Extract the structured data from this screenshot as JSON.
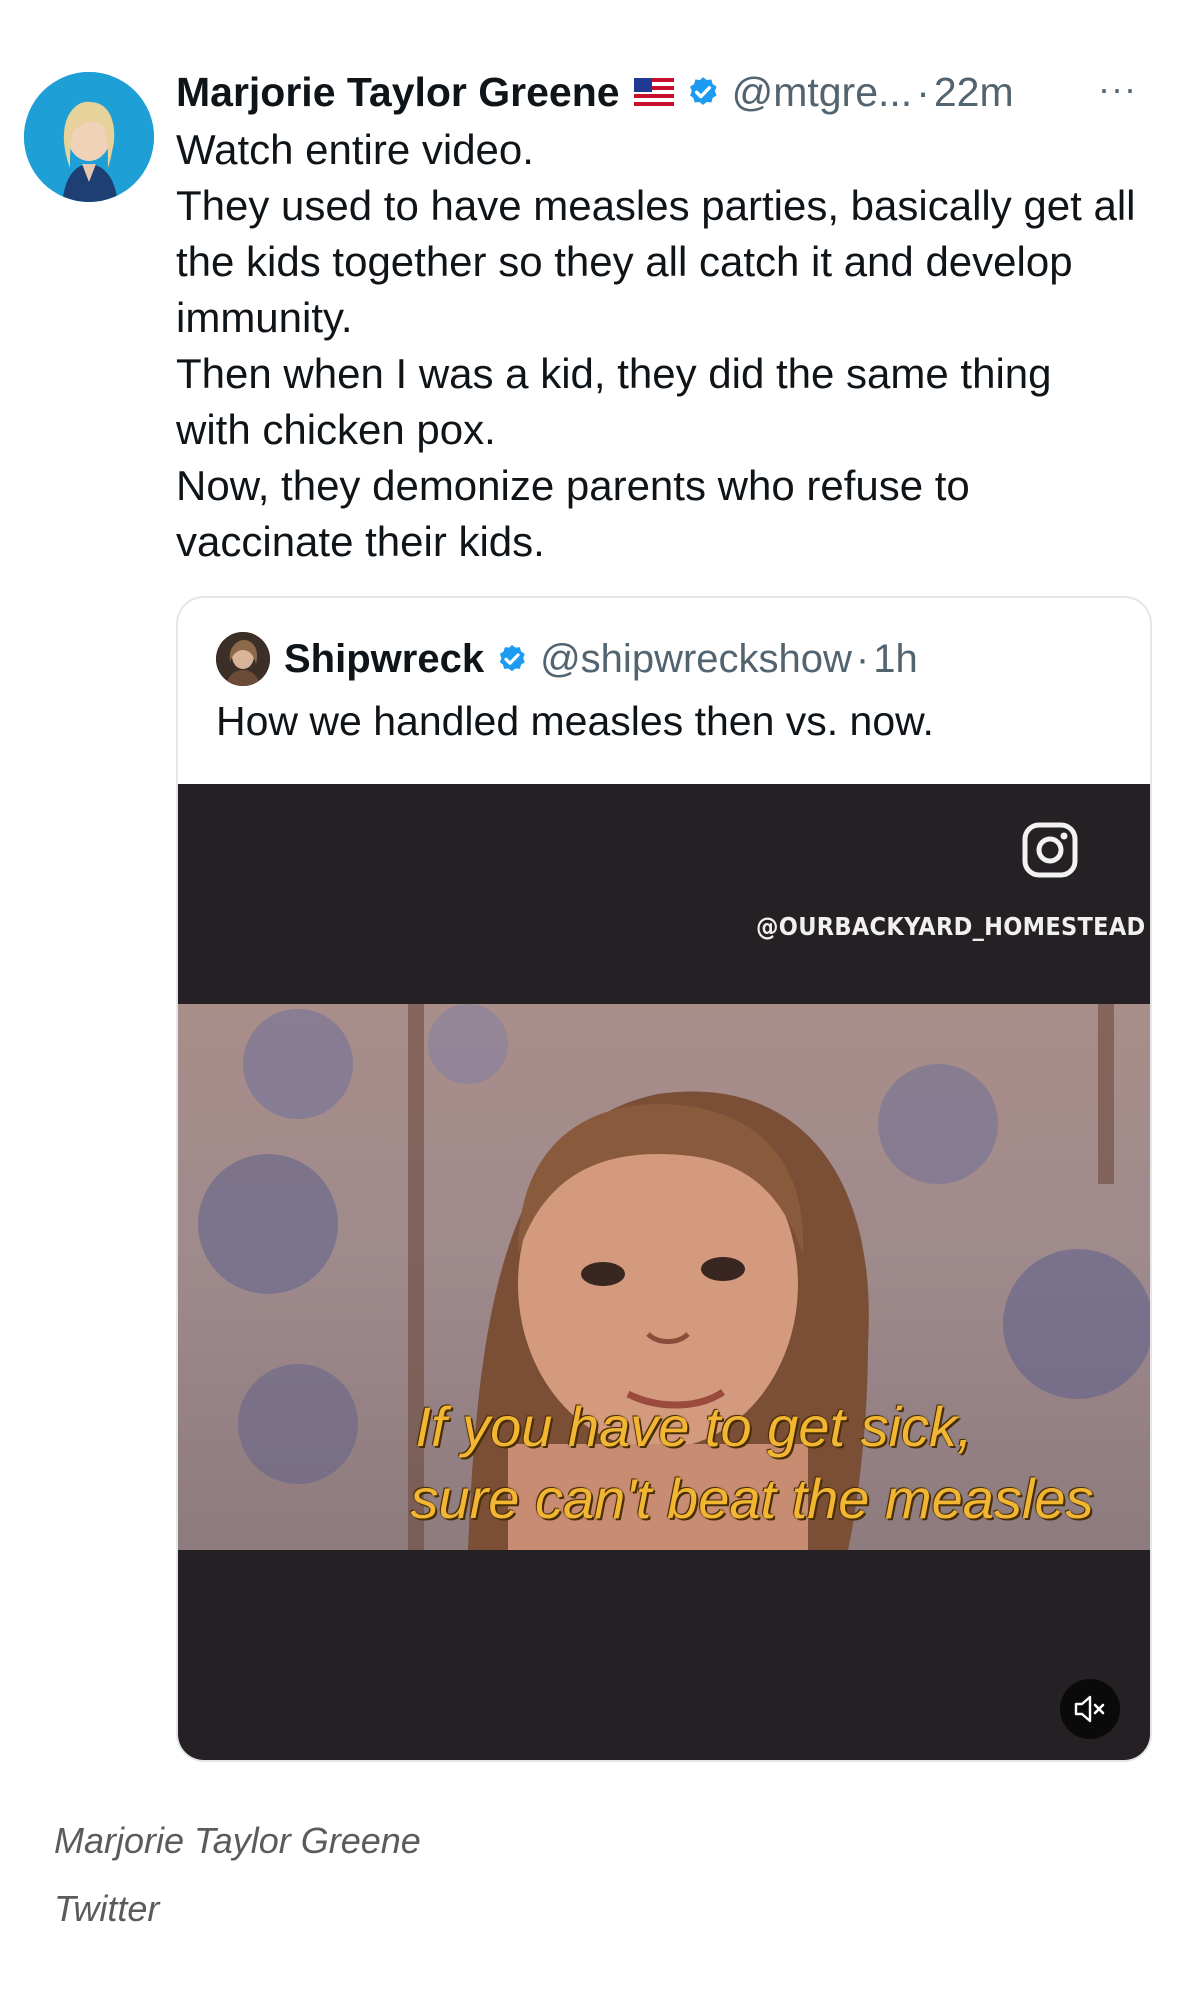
{
  "tweet": {
    "author_name": "Marjorie Taylor Greene",
    "handle": "@mtgre...",
    "separator": "·",
    "time": "22m",
    "more_label": "···",
    "lines": [
      "Watch entire video.",
      "They used to have measles parties, basically get all the kids together so they all catch it and develop immunity.",
      "Then when I was a kid, they did the same thing with chicken pox.",
      "Now, they demonize parents who refuse to vaccinate their kids."
    ]
  },
  "quoted_tweet": {
    "author_name": "Shipwreck",
    "handle": "@shipwreckshow",
    "separator": "·",
    "time": "1h",
    "text": "How we handled measles then vs. now.",
    "video": {
      "watermark": "@OURBACKYARD_HOMESTEAD",
      "caption_line1": "If you have to get sick,",
      "caption_line2": "sure can't beat the measles",
      "muted": true
    }
  },
  "credits": {
    "line1": "Marjorie Taylor Greene",
    "line2": "Twitter"
  },
  "colors": {
    "verified": "#1d9bf0",
    "secondary_text": "#536471",
    "caption": "#f2b632"
  },
  "icons": [
    "us-flag-icon",
    "verified-badge-icon",
    "more-icon",
    "instagram-icon",
    "mute-icon"
  ]
}
